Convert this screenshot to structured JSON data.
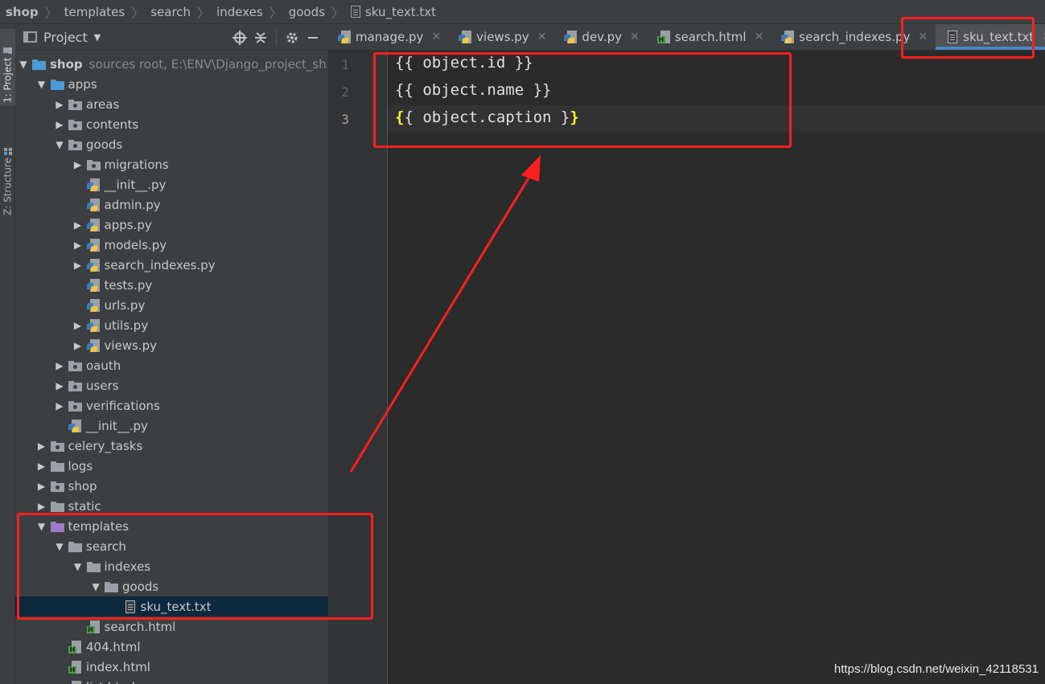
{
  "breadcrumb": {
    "items": [
      "shop",
      "templates",
      "search",
      "indexes",
      "goods",
      "sku_text.txt"
    ]
  },
  "left_strip": {
    "project_tab": "1: Project",
    "structure_tab": "Z: Structure"
  },
  "project_panel": {
    "title": "Project",
    "tree": [
      {
        "label": "shop",
        "hint": "sources root,  E:\\ENV\\Django_project_sh",
        "icon": "folder-blue-icon",
        "depth": 0,
        "expanded": true,
        "bold": true
      },
      {
        "label": "apps",
        "icon": "folder-blue-icon",
        "depth": 1,
        "expanded": true
      },
      {
        "label": "areas",
        "icon": "package-icon",
        "depth": 2,
        "expanded": false
      },
      {
        "label": "contents",
        "icon": "package-icon",
        "depth": 2,
        "expanded": false
      },
      {
        "label": "goods",
        "icon": "package-icon",
        "depth": 2,
        "expanded": true
      },
      {
        "label": "migrations",
        "icon": "package-icon",
        "depth": 3,
        "expanded": false
      },
      {
        "label": "__init__.py",
        "icon": "python-file-icon",
        "depth": 3,
        "leaf": true
      },
      {
        "label": "admin.py",
        "icon": "python-file-icon",
        "depth": 3,
        "leaf": true
      },
      {
        "label": "apps.py",
        "icon": "python-file-icon",
        "depth": 3,
        "expanded": false
      },
      {
        "label": "models.py",
        "icon": "python-file-icon",
        "depth": 3,
        "expanded": false
      },
      {
        "label": "search_indexes.py",
        "icon": "python-file-icon",
        "depth": 3,
        "expanded": false
      },
      {
        "label": "tests.py",
        "icon": "python-file-icon",
        "depth": 3,
        "leaf": true
      },
      {
        "label": "urls.py",
        "icon": "python-file-icon",
        "depth": 3,
        "leaf": true
      },
      {
        "label": "utils.py",
        "icon": "python-file-icon",
        "depth": 3,
        "expanded": false
      },
      {
        "label": "views.py",
        "icon": "python-file-icon",
        "depth": 3,
        "expanded": false
      },
      {
        "label": "oauth",
        "icon": "package-icon",
        "depth": 2,
        "expanded": false
      },
      {
        "label": "users",
        "icon": "package-icon",
        "depth": 2,
        "expanded": false
      },
      {
        "label": "verifications",
        "icon": "package-icon",
        "depth": 2,
        "expanded": false
      },
      {
        "label": "__init__.py",
        "icon": "python-file-icon",
        "depth": 2,
        "leaf": true
      },
      {
        "label": "celery_tasks",
        "icon": "package-icon",
        "depth": 1,
        "expanded": false
      },
      {
        "label": "logs",
        "icon": "folder-icon",
        "depth": 1,
        "expanded": false
      },
      {
        "label": "shop",
        "icon": "package-icon",
        "depth": 1,
        "expanded": false
      },
      {
        "label": "static",
        "icon": "folder-icon",
        "depth": 1,
        "expanded": false
      },
      {
        "label": "templates",
        "icon": "folder-purple-icon",
        "depth": 1,
        "expanded": true
      },
      {
        "label": "search",
        "icon": "folder-icon",
        "depth": 2,
        "expanded": true
      },
      {
        "label": "indexes",
        "icon": "folder-icon",
        "depth": 3,
        "expanded": true
      },
      {
        "label": "goods",
        "icon": "folder-icon",
        "depth": 4,
        "expanded": true
      },
      {
        "label": "sku_text.txt",
        "icon": "text-file-icon",
        "depth": 5,
        "leaf": true,
        "selected": true
      },
      {
        "label": "search.html",
        "icon": "html-file-icon",
        "depth": 3,
        "leaf": true
      },
      {
        "label": "404.html",
        "icon": "html-file-icon",
        "depth": 2,
        "leaf": true
      },
      {
        "label": "index.html",
        "icon": "html-file-icon",
        "depth": 2,
        "leaf": true
      },
      {
        "label": "list.html",
        "icon": "html-file-icon",
        "depth": 2,
        "leaf": true
      }
    ]
  },
  "tabs": [
    {
      "label": "manage.py",
      "icon": "python-file-icon",
      "active": false
    },
    {
      "label": "views.py",
      "icon": "python-file-icon",
      "active": false
    },
    {
      "label": "dev.py",
      "icon": "python-file-icon",
      "active": false
    },
    {
      "label": "search.html",
      "icon": "html-file-icon",
      "active": false
    },
    {
      "label": "search_indexes.py",
      "icon": "python-file-icon",
      "active": false
    },
    {
      "label": "sku_text.txt",
      "icon": "text-file-icon",
      "active": true
    }
  ],
  "editor": {
    "lines": [
      {
        "number": "1",
        "text": "{{ object.id }}"
      },
      {
        "number": "2",
        "text": "{{ object.name }}"
      },
      {
        "number": "3",
        "text_open": "{",
        "text_mid": "{ object.caption }",
        "text_close": "}"
      }
    ],
    "current_line": 3
  },
  "colors": {
    "annotation_red": "#ff1f1f",
    "active_tab_underline": "#4a88c7",
    "selection_bg": "#0d293e"
  },
  "watermark": "https://blog.csdn.net/weixin_42118531"
}
